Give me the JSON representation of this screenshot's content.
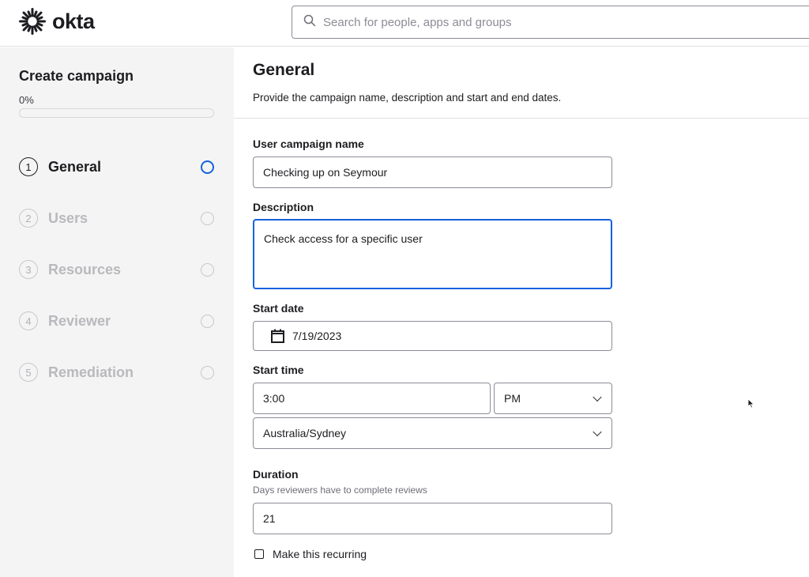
{
  "brand": {
    "name": "okta"
  },
  "search": {
    "placeholder": "Search for people, apps and groups"
  },
  "sidebar": {
    "title": "Create campaign",
    "progress_label": "0%",
    "progress": 0,
    "steps": [
      {
        "num": "1",
        "label": "General",
        "active": true
      },
      {
        "num": "2",
        "label": "Users",
        "active": false
      },
      {
        "num": "3",
        "label": "Resources",
        "active": false
      },
      {
        "num": "4",
        "label": "Reviewer",
        "active": false
      },
      {
        "num": "5",
        "label": "Remediation",
        "active": false
      }
    ]
  },
  "main": {
    "title": "General",
    "subtitle": "Provide the campaign name, description and start and end dates.",
    "campaign_name": {
      "label": "User campaign name",
      "value": "Checking up on Seymour"
    },
    "description": {
      "label": "Description",
      "value": "Check access for a specific user"
    },
    "start_date": {
      "label": "Start date",
      "value": "7/19/2023"
    },
    "start_time": {
      "label": "Start time",
      "value": "3:00",
      "ampm": "PM",
      "timezone": "Australia/Sydney"
    },
    "duration": {
      "label": "Duration",
      "hint": "Days reviewers have to complete reviews",
      "value": "21"
    },
    "recurring": {
      "label": "Make this recurring",
      "checked": false
    }
  },
  "colors": {
    "accent": "#1662dd",
    "sidebar_bg": "#f4f4f4",
    "muted": "#b9b9be"
  },
  "icons": [
    "okta-sunburst-logo",
    "search-icon",
    "calendar-icon",
    "chevron-down-icon",
    "mouse-cursor-icon"
  ]
}
